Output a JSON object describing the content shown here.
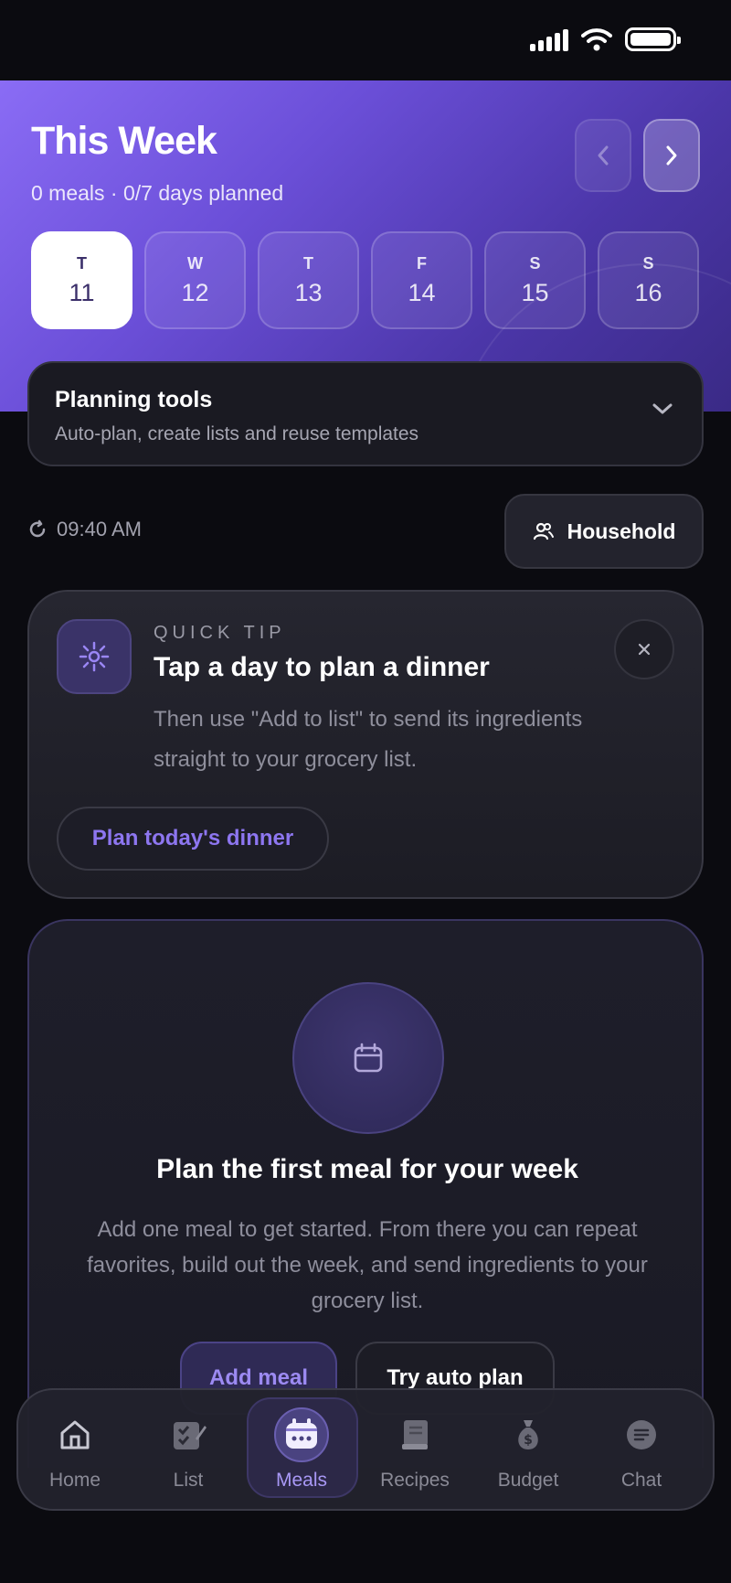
{
  "header": {
    "title": "This Week",
    "subtitle": "0 meals · 0/7 days planned"
  },
  "days": [
    {
      "letter": "T",
      "num": "11",
      "active": true
    },
    {
      "letter": "W",
      "num": "12"
    },
    {
      "letter": "T",
      "num": "13"
    },
    {
      "letter": "F",
      "num": "14"
    },
    {
      "letter": "S",
      "num": "15"
    },
    {
      "letter": "S",
      "num": "16"
    }
  ],
  "tools": {
    "title": "Planning tools",
    "subtitle": "Auto-plan, create lists and reuse templates"
  },
  "sync_time": "09:40 AM",
  "household_label": "Household",
  "tip": {
    "label": "QUICK TIP",
    "title": "Tap a day to plan a dinner",
    "text": "Then use \"Add to list\" to send its ingredients straight to your grocery list.",
    "button": "Plan today's dinner"
  },
  "empty_state": {
    "title": "Plan the first meal for your week",
    "text": "Add one meal to get started. From there you can repeat favorites, build out the week, and send ingredients to your grocery list.",
    "add_button": "Add meal",
    "auto_button": "Try auto plan"
  },
  "tabs": [
    {
      "label": "Home",
      "icon": "home-icon"
    },
    {
      "label": "List",
      "icon": "list-icon"
    },
    {
      "label": "Meals",
      "icon": "calendar-icon",
      "active": true
    },
    {
      "label": "Recipes",
      "icon": "book-icon"
    },
    {
      "label": "Budget",
      "icon": "money-bag-icon"
    },
    {
      "label": "Chat",
      "icon": "chat-icon"
    }
  ],
  "colors": {
    "accent": "#8d76f0",
    "hero_start": "#8a6cf5",
    "hero_end": "#3a2a86",
    "background": "#0b0b10"
  }
}
